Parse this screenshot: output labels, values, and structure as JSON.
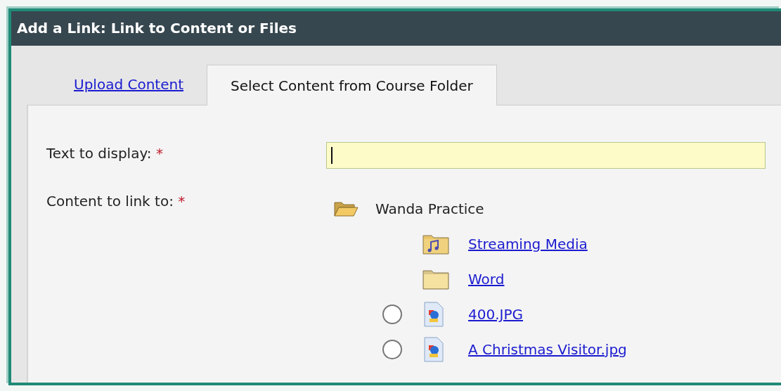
{
  "window": {
    "title": "Add a Link: Link to Content or Files"
  },
  "tabs": [
    {
      "label": "Upload Content",
      "selected": false
    },
    {
      "label": "Select Content from Course Folder",
      "selected": true
    }
  ],
  "form": {
    "text_field": {
      "label": "Text to display:",
      "required_mark": "*",
      "focused": true
    },
    "content_field": {
      "label": "Content to link to:",
      "required_mark": "*"
    }
  },
  "tree": {
    "label": "Wanda Practice",
    "kind": "folder",
    "expanded": true,
    "children": [
      {
        "label": "Streaming Media",
        "kind": "media_folder"
      },
      {
        "label": "Word",
        "kind": "folder"
      },
      {
        "label": "400.JPG",
        "kind": "image",
        "selected": false
      },
      {
        "label": "A Christmas Visitor.jpg",
        "kind": "image",
        "selected": false
      }
    ]
  }
}
